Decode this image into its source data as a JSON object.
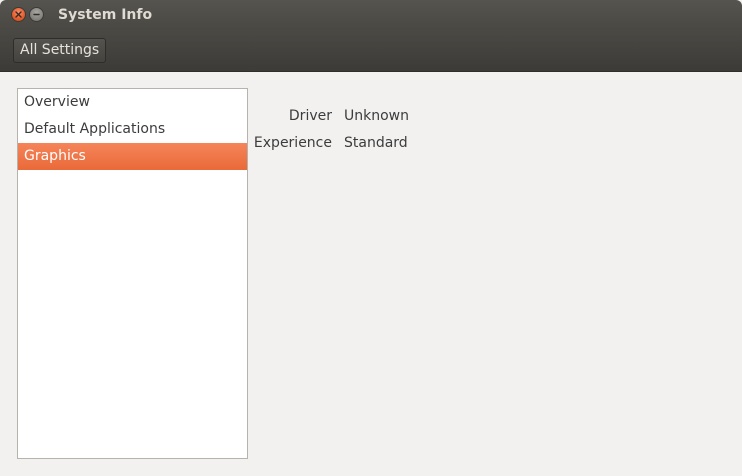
{
  "window": {
    "title": "System Info",
    "close_icon": "close-icon",
    "minimize_icon": "minimize-icon"
  },
  "toolbar": {
    "all_settings_label": "All Settings"
  },
  "sidebar": {
    "items": [
      {
        "label": "Overview",
        "selected": false
      },
      {
        "label": "Default Applications",
        "selected": false
      },
      {
        "label": "Graphics",
        "selected": true
      }
    ]
  },
  "graphics": {
    "rows": [
      {
        "label": "Driver",
        "value": "Unknown"
      },
      {
        "label": "Experience",
        "value": "Standard"
      }
    ]
  },
  "colors": {
    "accent": "#ea6a38",
    "titlebar": "#4a4843",
    "background": "#f2f1f0"
  }
}
